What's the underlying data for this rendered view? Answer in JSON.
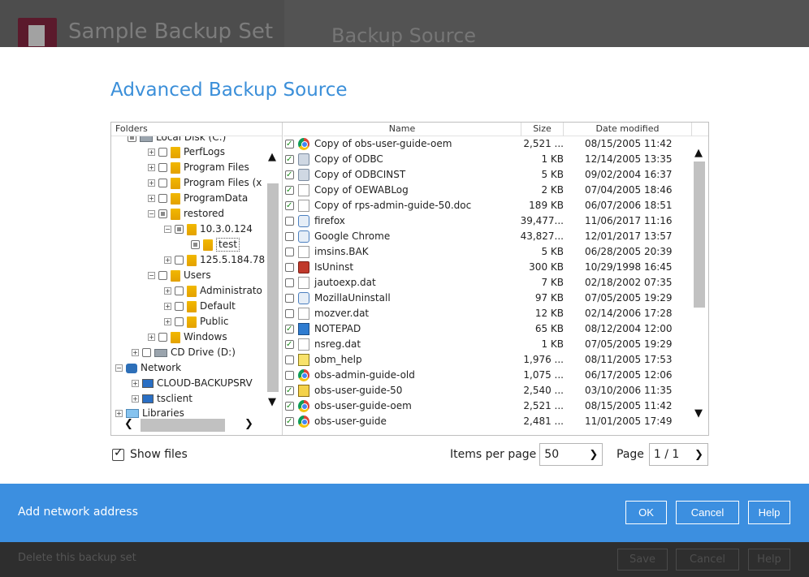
{
  "backdrop": {
    "app_title": "Sample Backup Set",
    "section_title": "Backup Source",
    "delete_link": "Delete this backup set",
    "save_label": "Save",
    "cancel_label": "Cancel",
    "help_label": "Help"
  },
  "dialog": {
    "title": "Advanced Backup Source",
    "folders_header": "Folders",
    "tree": [
      {
        "label": "Local Disk (C:)"
      },
      {
        "label": "PerfLogs"
      },
      {
        "label": "Program Files"
      },
      {
        "label": "Program Files (x"
      },
      {
        "label": "ProgramData"
      },
      {
        "label": "restored"
      },
      {
        "label": "10.3.0.124"
      },
      {
        "label": "test"
      },
      {
        "label": "125.5.184.78"
      },
      {
        "label": "Users"
      },
      {
        "label": "Administrato"
      },
      {
        "label": "Default"
      },
      {
        "label": "Public"
      },
      {
        "label": "Windows"
      },
      {
        "label": "CD Drive (D:)"
      },
      {
        "label": "Network"
      },
      {
        "label": "CLOUD-BACKUPSRV"
      },
      {
        "label": "tsclient"
      },
      {
        "label": "Libraries"
      }
    ],
    "columns": {
      "name": "Name",
      "size": "Size",
      "date": "Date modified"
    },
    "files": [
      {
        "name": "Copy of obs-user-guide-oem",
        "size": "2,521 ...",
        "date": "08/15/2005 11:42",
        "checked": true,
        "icon": "chrome-icon"
      },
      {
        "name": "Copy of ODBC",
        "size": "1 KB",
        "date": "12/14/2005 13:35",
        "checked": true,
        "icon": "settings-file-icon"
      },
      {
        "name": "Copy of ODBCINST",
        "size": "5 KB",
        "date": "09/02/2004 16:37",
        "checked": true,
        "icon": "settings-file-icon"
      },
      {
        "name": "Copy of OEWABLog",
        "size": "2 KB",
        "date": "07/04/2005 18:46",
        "checked": true,
        "icon": "document-icon"
      },
      {
        "name": "Copy of rps-admin-guide-50.doc",
        "size": "189 KB",
        "date": "06/07/2006 18:51",
        "checked": true,
        "icon": "document-icon"
      },
      {
        "name": "firefox",
        "size": "39,477...",
        "date": "11/06/2017 11:16",
        "checked": false,
        "icon": "application-icon"
      },
      {
        "name": "Google Chrome",
        "size": "43,827...",
        "date": "12/01/2017 13:57",
        "checked": false,
        "icon": "application-icon"
      },
      {
        "name": "imsins.BAK",
        "size": "5 KB",
        "date": "06/28/2005 20:39",
        "checked": false,
        "icon": "document-icon"
      },
      {
        "name": "IsUninst",
        "size": "300 KB",
        "date": "10/29/1998 16:45",
        "checked": false,
        "icon": "uninstaller-icon"
      },
      {
        "name": "jautoexp.dat",
        "size": "7 KB",
        "date": "02/18/2002 07:35",
        "checked": false,
        "icon": "document-icon"
      },
      {
        "name": "MozillaUninstall",
        "size": "97 KB",
        "date": "07/05/2005 19:29",
        "checked": false,
        "icon": "application-icon"
      },
      {
        "name": "mozver.dat",
        "size": "12 KB",
        "date": "02/14/2006 17:28",
        "checked": false,
        "icon": "document-icon"
      },
      {
        "name": "NOTEPAD",
        "size": "65 KB",
        "date": "08/12/2004 12:00",
        "checked": true,
        "icon": "notepad-icon"
      },
      {
        "name": "nsreg.dat",
        "size": "1 KB",
        "date": "07/05/2005 19:29",
        "checked": true,
        "icon": "document-icon"
      },
      {
        "name": "obm_help",
        "size": "1,976 ...",
        "date": "08/11/2005 17:53",
        "checked": false,
        "icon": "help-file-icon"
      },
      {
        "name": "obs-admin-guide-old",
        "size": "1,075 ...",
        "date": "06/17/2005 12:06",
        "checked": false,
        "icon": "chrome-icon"
      },
      {
        "name": "obs-user-guide-50",
        "size": "2,540 ...",
        "date": "03/10/2006 11:35",
        "checked": true,
        "icon": "archive-icon"
      },
      {
        "name": "obs-user-guide-oem",
        "size": "2,521 ...",
        "date": "08/15/2005 11:42",
        "checked": true,
        "icon": "chrome-icon"
      },
      {
        "name": "obs-user-guide",
        "size": "2,481 ...",
        "date": "11/01/2005 17:49",
        "checked": true,
        "icon": "chrome-icon"
      }
    ],
    "show_files_label": "Show files",
    "items_per_page_label": "Items per page",
    "items_per_page_value": "50",
    "page_label": "Page",
    "page_value": "1 / 1"
  },
  "footer": {
    "add_network_label": "Add network address",
    "ok_label": "OK",
    "cancel_label": "Cancel",
    "help_label": "Help",
    "color": "#3c8fe0"
  }
}
